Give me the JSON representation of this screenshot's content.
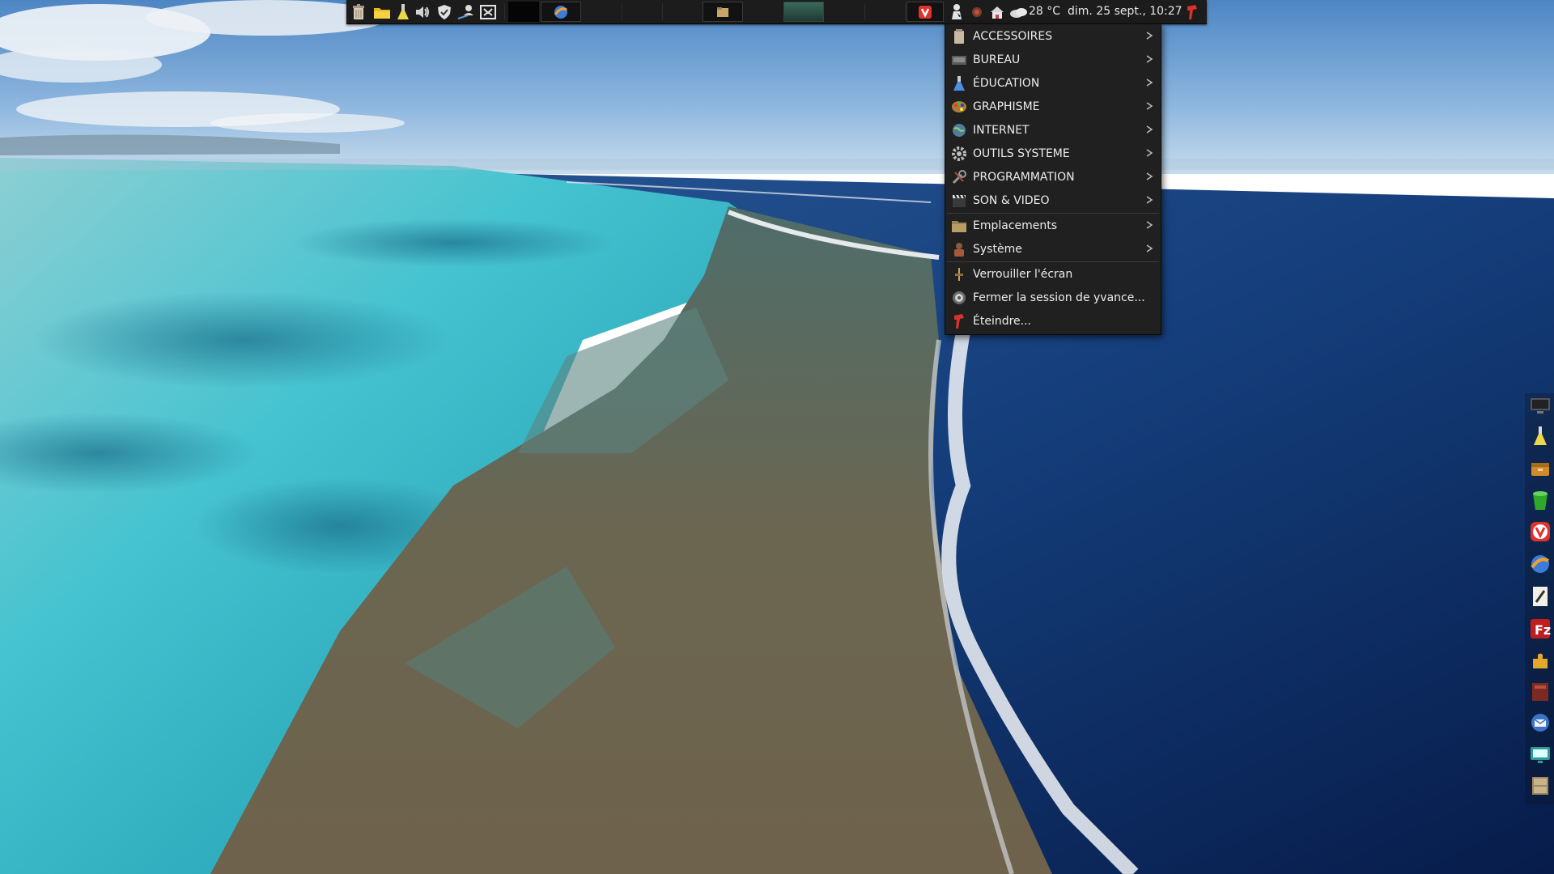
{
  "desktop": {
    "wallpaper": "coral-reef-aerial-icon"
  },
  "top_panel": {
    "launchers": [
      {
        "name": "trash-icon"
      },
      {
        "name": "folder-icon"
      },
      {
        "name": "flask-icon"
      },
      {
        "name": "volume-icon"
      },
      {
        "name": "shield-icon"
      },
      {
        "name": "user-network-icon"
      },
      {
        "name": "screenshot-icon"
      }
    ],
    "tasks": [
      {
        "name": "black-window-task"
      },
      {
        "name": "browser-globe-task"
      },
      {
        "name": "file-manager-task"
      },
      {
        "name": "active-window-task"
      },
      {
        "name": "vivaldi-task"
      }
    ],
    "tray": {
      "weather_icon": "cloud-icon",
      "temperature": "28 °C",
      "datetime": "dim. 25 sept., 10:27"
    },
    "colors": {
      "panel_bg": "#1c1c1c",
      "active_task": "#3b6a5a"
    }
  },
  "app_menu": {
    "categories": [
      {
        "label": "ACCESSOIRES",
        "icon": "accessories-icon"
      },
      {
        "label": "BUREAU",
        "icon": "office-icon"
      },
      {
        "label": "ÉDUCATION",
        "icon": "education-flask-icon"
      },
      {
        "label": "GRAPHISME",
        "icon": "graphics-palette-icon"
      },
      {
        "label": "INTERNET",
        "icon": "internet-globe-icon"
      },
      {
        "label": "OUTILS SYSTEME",
        "icon": "system-tools-icon"
      },
      {
        "label": "PROGRAMMATION",
        "icon": "programming-icon"
      },
      {
        "label": "SON & VIDEO",
        "icon": "multimedia-clapper-icon"
      }
    ],
    "places": [
      {
        "label": "Emplacements",
        "icon": "places-folder-icon"
      },
      {
        "label": "Système",
        "icon": "system-icon"
      }
    ],
    "actions": [
      {
        "label": "Verrouiller l'écran",
        "icon": "lock-screen-icon"
      },
      {
        "label": "Fermer la session de yvance...",
        "icon": "logout-icon"
      },
      {
        "label": "Éteindre...",
        "icon": "shutdown-icon"
      }
    ]
  },
  "right_dock": {
    "items": [
      {
        "name": "monitor-icon"
      },
      {
        "name": "flask-icon"
      },
      {
        "name": "archive-box-icon"
      },
      {
        "name": "green-bucket-icon"
      },
      {
        "name": "vivaldi-icon"
      },
      {
        "name": "browser-globe-icon"
      },
      {
        "name": "text-editor-icon"
      },
      {
        "name": "filezilla-icon"
      },
      {
        "name": "puzzle-icon"
      },
      {
        "name": "red-book-icon"
      },
      {
        "name": "mail-client-icon"
      },
      {
        "name": "remote-desktop-icon"
      },
      {
        "name": "file-cabinet-icon"
      }
    ]
  }
}
